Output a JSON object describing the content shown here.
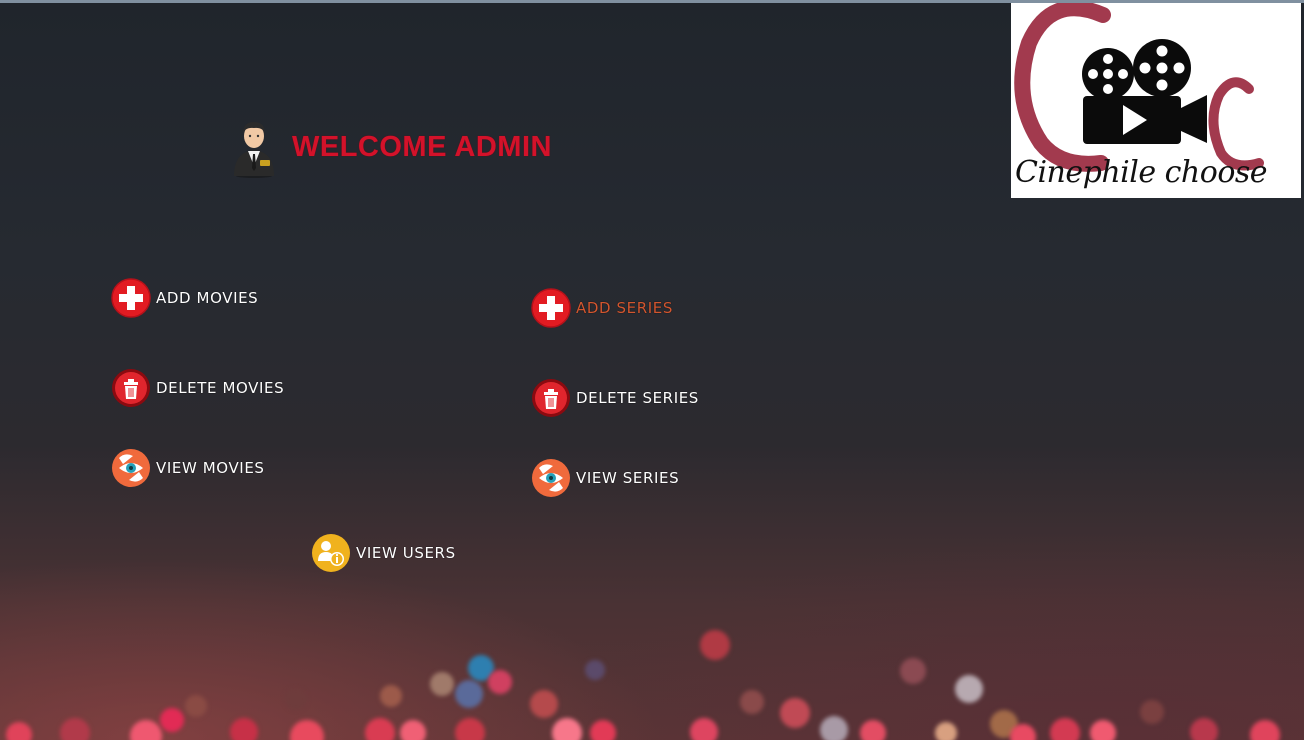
{
  "header": {
    "welcome_text": "WELCOME ADMIN"
  },
  "logo": {
    "text": "Cinephile choose"
  },
  "menu": {
    "add_movies": "ADD MOVIES",
    "delete_movies": "DELETE MOVIES",
    "view_movies": "VIEW MOVIES",
    "add_series": "ADD SERIES",
    "delete_series": "DELETE SERIES",
    "view_series": "VIEW SERIES",
    "view_users": "VIEW USERS"
  },
  "colors": {
    "welcome": "#d3122a",
    "active_link": "#d2562f",
    "link": "#ffffff",
    "logo_accent": "#a23a4e"
  }
}
